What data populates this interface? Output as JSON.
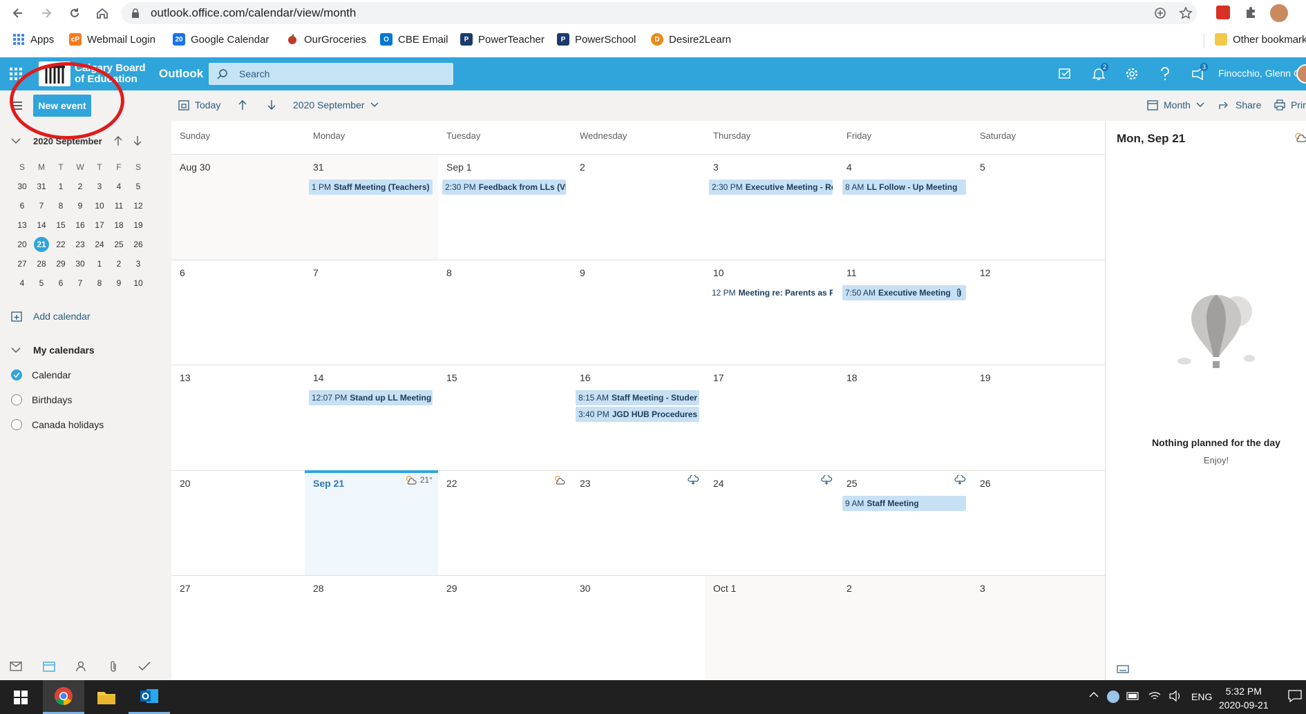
{
  "browser": {
    "url": "outlook.office.com/calendar/view/month",
    "bookmarks": [
      {
        "label": "Apps",
        "icon": "apps-grid-icon",
        "color": "#4285f4"
      },
      {
        "label": "Webmail Login",
        "icon": "webmail-icon",
        "color": "#f47b20"
      },
      {
        "label": "Google Calendar",
        "icon": "google-calendar-icon",
        "color": "#1a73e8"
      },
      {
        "label": "OurGroceries",
        "icon": "ourgroceries-icon",
        "color": "#c0392b"
      },
      {
        "label": "CBE Email",
        "icon": "outlook-icon",
        "color": "#0078d4"
      },
      {
        "label": "PowerTeacher",
        "icon": "powerteacher-icon",
        "color": "#1b3a6b"
      },
      {
        "label": "PowerSchool",
        "icon": "powerschool-icon",
        "color": "#1b3a6b"
      },
      {
        "label": "Desire2Learn",
        "icon": "d2l-icon",
        "color": "#e88a1a"
      },
      {
        "label": "Other bookmarks",
        "icon": "folder-icon",
        "color": "#f2c94c"
      }
    ]
  },
  "header": {
    "logo_text": "Calgary Board\nof Education",
    "app_name": "Outlook",
    "search_placeholder": "Search",
    "notification_count": "2",
    "feedback_count": "3",
    "user_name": "Finocchio, Glenn O",
    "accent": "#2fa5dc"
  },
  "sidebar": {
    "new_event_label": "New event",
    "mini_month_title": "2020 September",
    "weekdays": [
      "S",
      "M",
      "T",
      "W",
      "T",
      "F",
      "S"
    ],
    "weeks": [
      [
        "30",
        "31",
        "1",
        "2",
        "3",
        "4",
        "5"
      ],
      [
        "6",
        "7",
        "8",
        "9",
        "10",
        "11",
        "12"
      ],
      [
        "13",
        "14",
        "15",
        "16",
        "17",
        "18",
        "19"
      ],
      [
        "20",
        "21",
        "22",
        "23",
        "24",
        "25",
        "26"
      ],
      [
        "27",
        "28",
        "29",
        "30",
        "1",
        "2",
        "3"
      ],
      [
        "4",
        "5",
        "6",
        "7",
        "8",
        "9",
        "10"
      ]
    ],
    "today": "21",
    "add_calendar": "Add calendar",
    "my_calendars": "My calendars",
    "calendars": [
      {
        "label": "Calendar",
        "checked": true
      },
      {
        "label": "Birthdays",
        "checked": false
      },
      {
        "label": "Canada holidays",
        "checked": false
      }
    ]
  },
  "toolbar": {
    "today": "Today",
    "month_label": "2020 September",
    "view": "Month",
    "share": "Share",
    "print": "Print"
  },
  "calendar": {
    "day_headers": [
      "Sunday",
      "Monday",
      "Tuesday",
      "Wednesday",
      "Thursday",
      "Friday",
      "Saturday"
    ],
    "weeks": [
      {
        "days": [
          {
            "label": "Aug 30",
            "current": false
          },
          {
            "label": "31",
            "current": false,
            "events": [
              {
                "time": "1 PM",
                "title": "Staff Meeting (Teachers)",
                "style": "blue"
              }
            ]
          },
          {
            "label": "Sep 1",
            "current": true,
            "events": [
              {
                "time": "2:30 PM",
                "title": "Feedback from LLs (Vir",
                "style": "blue"
              }
            ]
          },
          {
            "label": "2",
            "current": true
          },
          {
            "label": "3",
            "current": true,
            "events": [
              {
                "time": "2:30 PM",
                "title": "Executive Meeting - Re",
                "style": "blue"
              }
            ]
          },
          {
            "label": "4",
            "current": true,
            "events": [
              {
                "time": "8 AM",
                "title": "LL Follow - Up Meeting",
                "style": "blue"
              }
            ]
          },
          {
            "label": "5",
            "current": true
          }
        ]
      },
      {
        "days": [
          {
            "label": "6",
            "current": true
          },
          {
            "label": "7",
            "current": true
          },
          {
            "label": "8",
            "current": true
          },
          {
            "label": "9",
            "current": true
          },
          {
            "label": "10",
            "current": true,
            "events": [
              {
                "time": "12 PM",
                "title": "Meeting re: Parents as P",
                "style": "plain"
              }
            ]
          },
          {
            "label": "11",
            "current": true,
            "events": [
              {
                "time": "7:50 AM",
                "title": "Executive Meeting",
                "style": "blue",
                "attachment": true
              }
            ]
          },
          {
            "label": "12",
            "current": true
          }
        ]
      },
      {
        "days": [
          {
            "label": "13",
            "current": true
          },
          {
            "label": "14",
            "current": true,
            "events": [
              {
                "time": "12:07 PM",
                "title": "Stand up LL Meeting",
                "style": "blue"
              }
            ]
          },
          {
            "label": "15",
            "current": true
          },
          {
            "label": "16",
            "current": true,
            "events": [
              {
                "time": "8:15 AM",
                "title": "Staff Meeting - Studer",
                "style": "blue"
              },
              {
                "time": "3:40 PM",
                "title": "JGD HUB Procedures f",
                "style": "blue"
              }
            ]
          },
          {
            "label": "17",
            "current": true
          },
          {
            "label": "18",
            "current": true
          },
          {
            "label": "19",
            "current": true
          }
        ]
      },
      {
        "days": [
          {
            "label": "20",
            "current": true
          },
          {
            "label": "Sep 21",
            "current": true,
            "today": true,
            "weather": "partly-cloudy-icon",
            "temp": "21°"
          },
          {
            "label": "22",
            "current": true,
            "weather": "partly-cloudy-icon"
          },
          {
            "label": "23",
            "current": true,
            "weather": "cloud-rain-icon"
          },
          {
            "label": "24",
            "current": true,
            "weather": "cloud-rain-icon"
          },
          {
            "label": "25",
            "current": true,
            "weather": "cloud-rain-icon",
            "events": [
              {
                "time": "9 AM",
                "title": "Staff Meeting",
                "style": "blue"
              }
            ]
          },
          {
            "label": "26",
            "current": true
          }
        ]
      },
      {
        "days": [
          {
            "label": "27",
            "current": true
          },
          {
            "label": "28",
            "current": true
          },
          {
            "label": "29",
            "current": true
          },
          {
            "label": "30",
            "current": true
          },
          {
            "label": "Oct 1",
            "current": false
          },
          {
            "label": "2",
            "current": false
          },
          {
            "label": "3",
            "current": false
          }
        ]
      }
    ]
  },
  "agenda": {
    "date": "Mon, Sep 21",
    "empty_title": "Nothing planned for the day",
    "empty_subtitle": "Enjoy!"
  },
  "taskbar": {
    "language": "ENG",
    "time": "5:32 PM",
    "date": "2020-09-21"
  }
}
